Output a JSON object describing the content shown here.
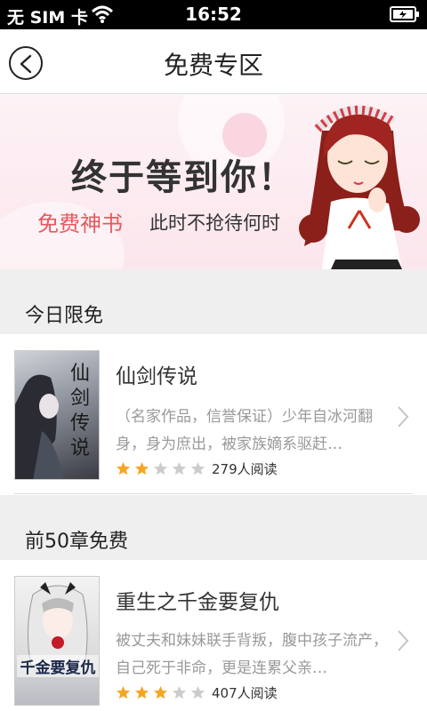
{
  "status_bar": {
    "carrier": "无 SIM 卡",
    "time": "16:52"
  },
  "nav": {
    "title": "免费专区"
  },
  "banner": {
    "headline": "终于等到你！",
    "sub_highlight": "免费神书",
    "sub_text": "此时不抢待何时"
  },
  "sections": [
    {
      "title": "今日限免"
    },
    {
      "title": "前50章免费"
    }
  ],
  "books": [
    {
      "title": "仙剑传说",
      "cover_text": "仙剑传说",
      "description": "（名家作品，信誉保证）少年自冰河翻身，身为庶出，被家族嫡系驱赶…",
      "rating": 2,
      "readers": "279人阅读"
    },
    {
      "title": "重生之千金要复仇",
      "cover_text": "千金要复仇",
      "description": "被丈夫和妹妹联手背叛，腹中孩子流产，自己死于非命，更是连累父亲…",
      "rating": 3,
      "readers": "407人阅读"
    }
  ],
  "colors": {
    "accent": "#e8585e",
    "star_on": "#f5a623",
    "star_off": "#cccccc",
    "section_bg": "#efefef"
  },
  "icons": {
    "back": "back-arrow-icon",
    "wifi": "wifi-icon",
    "battery": "battery-icon",
    "chevron": "chevron-right-icon",
    "star": "star-icon"
  }
}
